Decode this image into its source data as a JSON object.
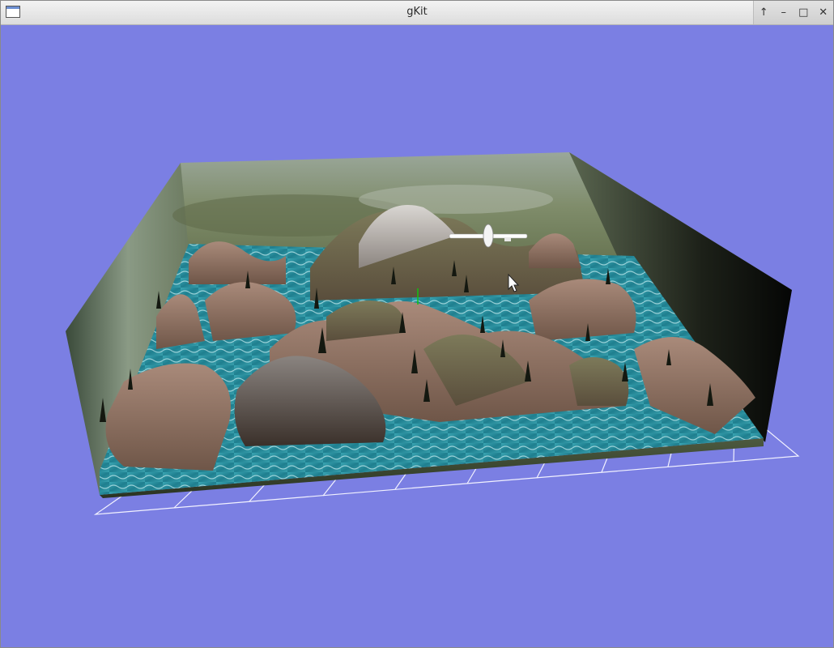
{
  "window": {
    "title": "gKit",
    "controls": {
      "shade": "↑",
      "minimize": "–",
      "maximize": "□",
      "close": "✕"
    }
  },
  "scene": {
    "background_color": "#7b7fe3",
    "grid_color": "#f2f2ff",
    "water_color": "#2a8fa0",
    "rock_color": "#9b7866",
    "sky_color": "#8c9a7a",
    "icons": {
      "app": "window-icon",
      "plane": "airplane",
      "trees": "cypress-tree",
      "cursor": "mouse-pointer"
    }
  }
}
